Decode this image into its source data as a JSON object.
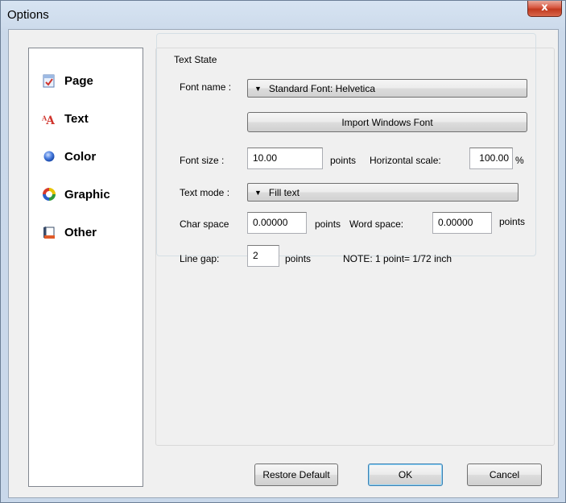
{
  "window": {
    "title": "Options",
    "close_glyph": "x"
  },
  "sidebar": {
    "items": [
      {
        "label": "Page",
        "icon": "page-icon"
      },
      {
        "label": "Text",
        "icon": "text-icon"
      },
      {
        "label": "Color",
        "icon": "color-icon"
      },
      {
        "label": "Graphic",
        "icon": "graphic-icon"
      },
      {
        "label": "Other",
        "icon": "other-icon"
      }
    ]
  },
  "text_state": {
    "group_title": "Text State",
    "font_name_label": "Font name :",
    "font_name_value": "Standard Font: Helvetica",
    "import_button": "Import Windows Font",
    "font_size_label": "Font size :",
    "font_size_value": "10.00",
    "font_size_unit": "points",
    "hscale_label": "Horizontal scale:",
    "hscale_value": "100.00",
    "hscale_unit": "%",
    "text_mode_label": "Text mode :",
    "text_mode_value": "Fill text",
    "char_space_label": "Char space",
    "char_space_value": "0.00000",
    "char_space_unit": "points",
    "word_space_label": "Word space:",
    "word_space_value": "0.00000",
    "word_space_unit": "points",
    "line_gap_label": "Line gap:",
    "line_gap_value": "2",
    "line_gap_unit": "points",
    "note": "NOTE: 1 point= 1/72 inch"
  },
  "footer": {
    "restore_default": "Restore Default",
    "ok": "OK",
    "cancel": "Cancel"
  }
}
